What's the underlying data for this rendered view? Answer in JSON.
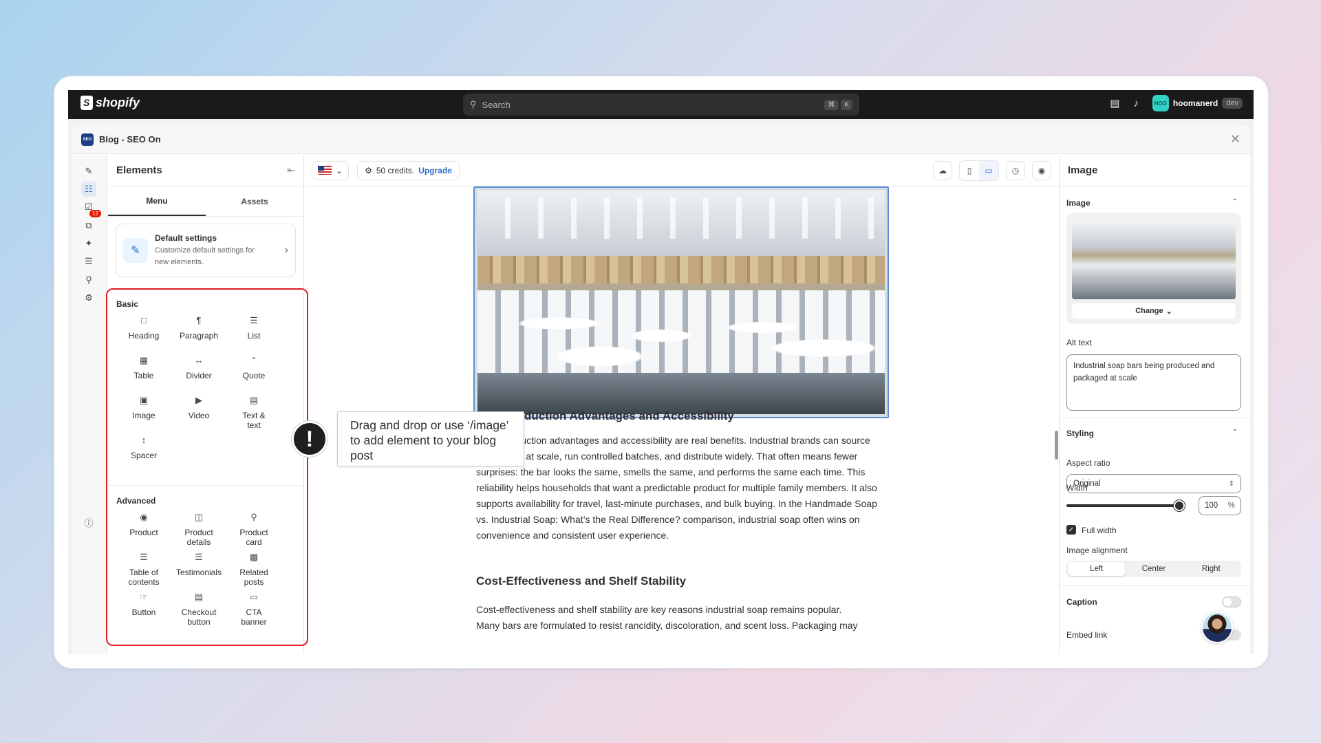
{
  "topbar": {
    "brand": "shopify",
    "search_placeholder": "Search",
    "shortcut_keys": [
      "⌘",
      "K"
    ],
    "username": "hoomanerd",
    "user_initials": "HOO",
    "user_badge": "dev"
  },
  "app": {
    "icon_text": "SEO",
    "title": "Blog - SEO On"
  },
  "rail": {
    "notification_count": "12"
  },
  "elements_panel": {
    "title": "Elements",
    "tabs": [
      "Menu",
      "Assets"
    ],
    "default_settings": {
      "title": "Default settings",
      "description": "Customize default settings for new elements."
    },
    "basic_title": "Basic",
    "basic_items": [
      "Heading",
      "Paragraph",
      "List",
      "Table",
      "Divider",
      "Quote",
      "Image",
      "Video",
      "Text & text",
      "Spacer"
    ],
    "advanced_title": "Advanced",
    "advanced_items": [
      "Product",
      "Product details",
      "Product card",
      "Table of contents",
      "Testimonials",
      "Related posts",
      "Button",
      "Checkout button",
      "CTA banner"
    ]
  },
  "tooltip": {
    "text": "Drag and drop or use ‘/image’ to add element to your blog post"
  },
  "canvas_toolbar": {
    "credits_text": "50 credits.",
    "upgrade_label": "Upgrade"
  },
  "article": {
    "heading1_partial": "duction Advantages and Accessibility",
    "paragraph1": "Mass production advantages and accessibility are real benefits. Industrial brands can source ingredients at scale, run controlled batches, and distribute widely. That often means fewer surprises: the bar looks the same, smells the same, and performs the same each time. This reliability helps households that want a predictable product for multiple family members. It also supports availability for travel, last-minute purchases, and bulk buying. In the Handmade Soap vs. Industrial Soap: What’s the Real Difference? comparison, industrial soap often wins on convenience and consistent user experience.",
    "heading2": "Cost-Effectiveness and Shelf Stability",
    "paragraph2": "Cost-effectiveness and shelf stability are key reasons industrial soap remains popular.",
    "paragraph2_cut": "Many bars are formulated to resist rancidity, discoloration, and scent loss. Packaging may"
  },
  "right_panel": {
    "title": "Image",
    "image_section": "Image",
    "change_label": "Change",
    "alt_label": "Alt text",
    "alt_value": "Industrial soap bars being produced and packaged at scale",
    "styling_section": "Styling",
    "aspect_label": "Aspect ratio",
    "aspect_value": "Original",
    "width_label": "Width",
    "width_value": "100",
    "width_unit": "%",
    "width_fraction": 1.0,
    "full_width_label": "Full width",
    "full_width_checked": true,
    "alignment_label": "Image alignment",
    "alignment_options": [
      "Left",
      "Center",
      "Right"
    ],
    "alignment_selected": "Left",
    "caption_label": "Caption",
    "embed_label": "Embed link"
  },
  "colors": {
    "accent": "#2c6ecb",
    "highlight_box": "#e31b23",
    "topbar": "#1a1a1a"
  }
}
